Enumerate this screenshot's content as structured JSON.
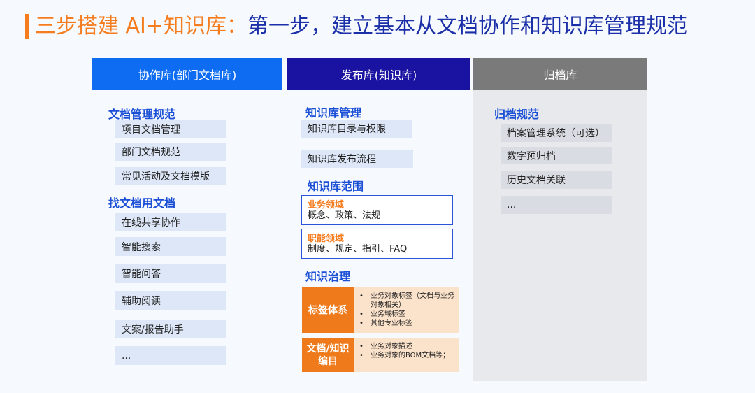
{
  "title": {
    "prefix": "三步搭建 AI+知识库：",
    "main": "第一步，建立基本从文档协作和知识库管理规范"
  },
  "columns": {
    "collab": {
      "header": "协作库(部门文档库)",
      "sections": [
        {
          "title": "文档管理规范",
          "items": [
            "项目文档管理",
            "部门文档规范",
            "常见活动及文档模版"
          ]
        },
        {
          "title": "找文档用文档",
          "items": [
            "在线共享协作",
            "智能搜索",
            "智能问答",
            "辅助阅读",
            "文案/报告助手",
            "..."
          ]
        }
      ]
    },
    "publish": {
      "header": "发布库(知识库)",
      "mgmt": {
        "title": "知识库管理",
        "items": [
          "知识库目录与权限",
          "知识库发布流程"
        ]
      },
      "scope": {
        "title": "知识库范围",
        "boxes": [
          {
            "title": "业务领域",
            "body": "概念、政策、法规"
          },
          {
            "title": "职能领域",
            "body": "制度、规定、指引、FAQ"
          }
        ]
      },
      "gov": {
        "title": "知识治理",
        "blocks": [
          {
            "label": "标签体系",
            "bullets": [
              "业务对象标签（文档与业务对象相关）",
              "业务域标签",
              "其他专业标签"
            ]
          },
          {
            "label": "文档/知识编目",
            "bullets": [
              "业务对象描述",
              "业务对象的BOM文档等；"
            ]
          }
        ]
      }
    },
    "archive": {
      "header": "归档库",
      "section": {
        "title": "归档规范",
        "items": [
          "档案管理系统（可选）",
          "数字预归档",
          "历史文档关联",
          "..."
        ]
      }
    }
  },
  "colors": {
    "accent_orange": "#f57c1f",
    "title_blue": "#1b2fa8",
    "header_blue": "#0d6cf2",
    "header_navy": "#1a12a0",
    "header_gray": "#7a7a7a"
  }
}
